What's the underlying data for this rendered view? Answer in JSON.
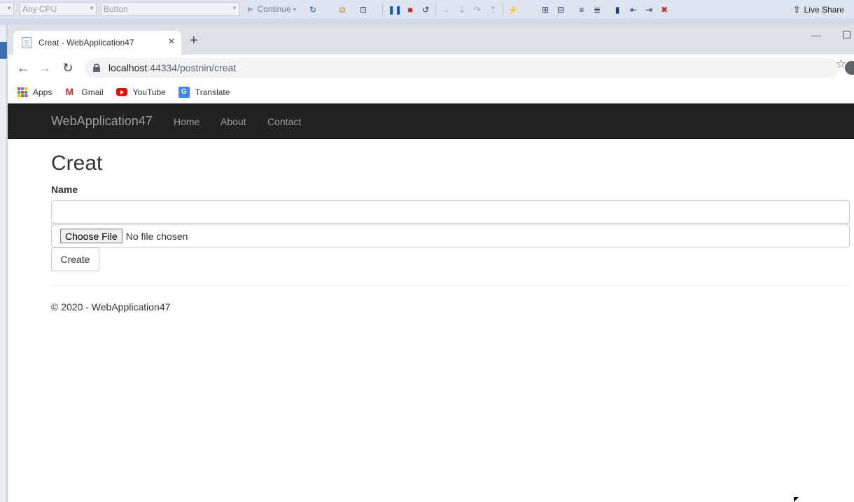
{
  "vs": {
    "platform_dropdown": "Any CPU",
    "startup_dropdown": "Button",
    "continue_label": "Continue",
    "live_share_label": "Live Share"
  },
  "browser": {
    "tab_title": "Creat - WebApplication47",
    "url_host": "localhost",
    "url_rest": ":44334/postnin/creat",
    "bookmarks": [
      {
        "label": "Apps"
      },
      {
        "label": "Gmail"
      },
      {
        "label": "YouTube"
      },
      {
        "label": "Translate"
      }
    ]
  },
  "site": {
    "brand": "WebApplication47",
    "nav": [
      "Home",
      "About",
      "Contact"
    ],
    "nav_bg": "#222222",
    "nav_text_color": "#9d9d9d"
  },
  "form": {
    "title": "Creat",
    "name_label": "Name",
    "name_value": "",
    "choose_file_label": "Choose File",
    "no_file_text": "No file chosen",
    "create_label": "Create"
  },
  "footer": {
    "text": "© 2020 - WebApplication47"
  }
}
